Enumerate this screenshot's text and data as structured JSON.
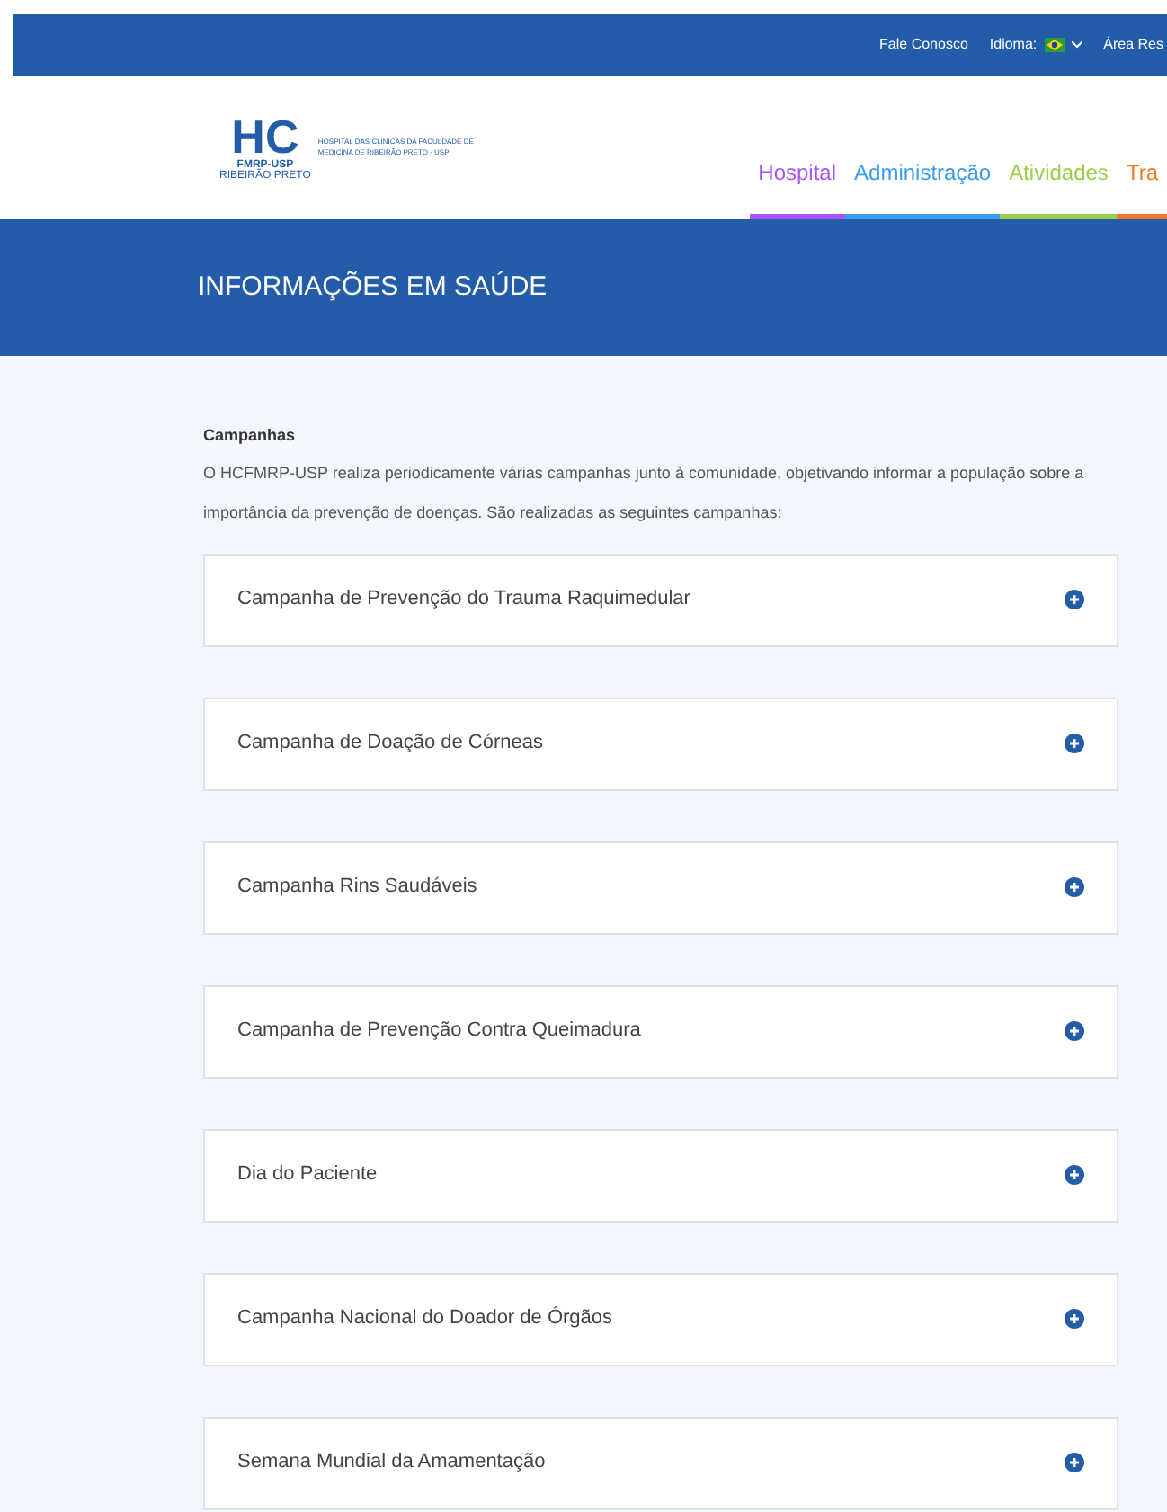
{
  "top_bar": {
    "links": [
      {
        "kind": "link",
        "label": "Fale Conosco"
      },
      {
        "kind": "language",
        "label": "Idioma:"
      },
      {
        "kind": "link",
        "label": "Área Res"
      }
    ]
  },
  "logo": {
    "mark": "HC",
    "sub": "FMRP-USP",
    "city": "RIBEIRÃO PRETO",
    "name": "HOSPITAL DAS CLÍNICAS DA FACULDADE DE MEDICINA DE RIBEIRÃO PRETO - USP"
  },
  "nav": [
    {
      "label": "Hospital",
      "color": "#a855f7"
    },
    {
      "label": "Administração",
      "color": "#3b9cf0"
    },
    {
      "label": "Atividades",
      "color": "#9ccc4a"
    },
    {
      "label": "Tra",
      "color": "#f07a2a"
    }
  ],
  "banner": {
    "title": "INFORMAÇÕES EM SAÚDE"
  },
  "intro": {
    "heading": "Campanhas",
    "text": "O HCFMRP-USP realiza periodicamente várias campanhas junto à comunidade, objetivando informar a população sobre a importância da prevenção de doenças. São realizadas as seguintes campanhas:"
  },
  "campaigns": [
    {
      "title": "Campanha de Prevenção do Trauma Raquimedular",
      "expanded": false
    },
    {
      "title": "Campanha de Doação de Córneas",
      "expanded": false
    },
    {
      "title": "Campanha Rins Saudáveis",
      "expanded": false
    },
    {
      "title": "Campanha de Prevenção Contra Queimadura",
      "expanded": false
    },
    {
      "title": "Dia do Paciente",
      "expanded": false
    },
    {
      "title": "Campanha Nacional do Doador de Órgãos",
      "expanded": false
    },
    {
      "title": "Semana Mundial da Amamentação",
      "expanded": false
    }
  ]
}
